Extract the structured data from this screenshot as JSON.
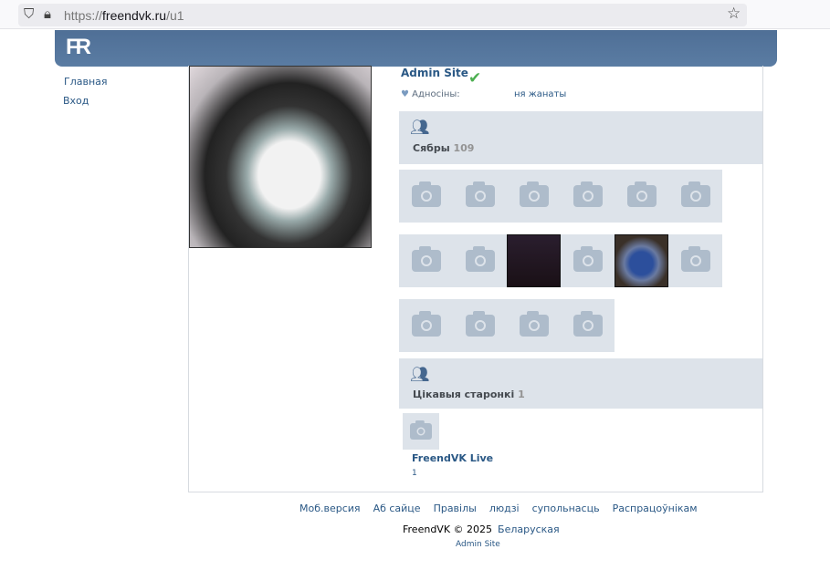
{
  "browser": {
    "url_prefix": "https://",
    "url_domain": "freendvk.ru",
    "url_path": "/u1"
  },
  "header": {
    "logo": "FR"
  },
  "nav": [
    {
      "label": "Главная"
    },
    {
      "label": "Вход"
    }
  ],
  "profile": {
    "name": "Admin Site",
    "verified": true,
    "relationship_label": "Адносіны:",
    "relationship_value": "ня жанаты"
  },
  "friends": {
    "title": "Сябры",
    "count": "109",
    "rows": [
      [
        "camera",
        "camera",
        "camera",
        "camera",
        "camera",
        "camera"
      ],
      [
        "camera",
        "camera",
        "photo-dark",
        "camera",
        "photo-dog",
        "camera"
      ],
      [
        "camera",
        "camera",
        "camera",
        "camera"
      ]
    ]
  },
  "pages": {
    "title": "Цікавыя старонкі",
    "count": "1",
    "items": [
      {
        "name": "FreendVK Live",
        "count": "1"
      }
    ]
  },
  "footer": {
    "links": [
      "Моб.версия",
      "Аб сайце",
      "Правілы",
      "людзі",
      "супольнасць",
      "Распрацоўнікам"
    ],
    "copyright": "FreendVK © 2025",
    "language": "Беларуская",
    "user_first": "Admin",
    "user_last": "Site"
  },
  "colors": {
    "header": "#52739a",
    "link": "#2a5885",
    "section_bg": "#dde3ea"
  }
}
